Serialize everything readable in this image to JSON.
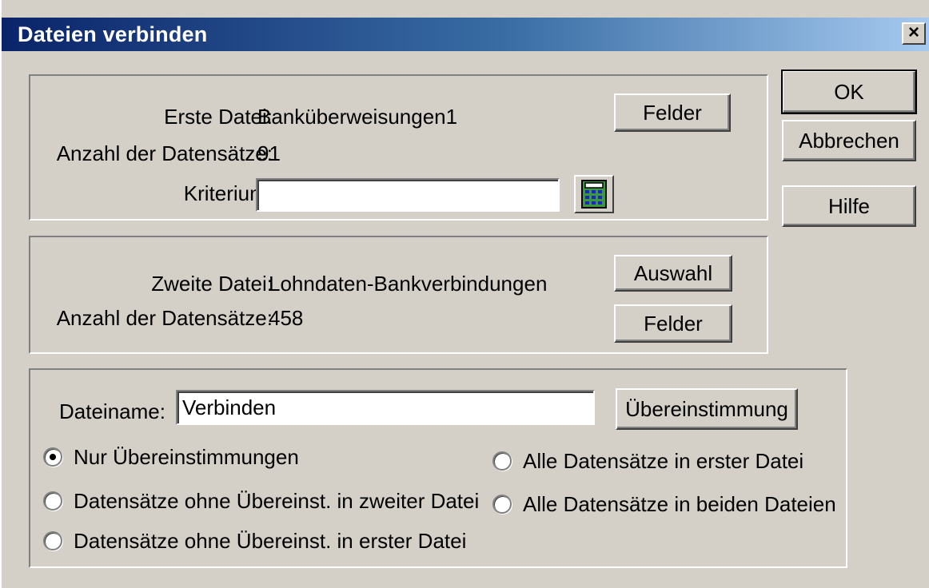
{
  "dialog": {
    "title": "Dateien verbinden",
    "close_glyph": "×"
  },
  "first_file": {
    "label": "Erste Datei:",
    "name": "Banküberweisungen1",
    "count_label": "Anzahl der Datensätze:",
    "count": "91",
    "criterion_label": "Kriterium:",
    "criterion_value": "",
    "fields_button": "Felder"
  },
  "second_file": {
    "label": "Zweite Datei:",
    "name": "Lohndaten-Bankverbindungen",
    "count_label": "Anzahl der Datensätze:",
    "count": "458",
    "select_button": "Auswahl",
    "fields_button": "Felder"
  },
  "output": {
    "filename_label": "Dateiname:",
    "filename_value": "Verbinden",
    "match_button": "Übereinstimmung",
    "options": [
      {
        "label": "Nur Übereinstimmungen",
        "selected": true
      },
      {
        "label": "Datensätze ohne Übereinst. in zweiter Datei",
        "selected": false
      },
      {
        "label": "Datensätze ohne Übereinst. in erster Datei",
        "selected": false
      },
      {
        "label": "Alle Datensätze in erster Datei",
        "selected": false
      },
      {
        "label": "Alle Datensätze in beiden Dateien",
        "selected": false
      }
    ]
  },
  "buttons": {
    "ok": "OK",
    "cancel": "Abbrechen",
    "help": "Hilfe"
  },
  "icons": {
    "criterion_editor": "calculator-icon"
  }
}
